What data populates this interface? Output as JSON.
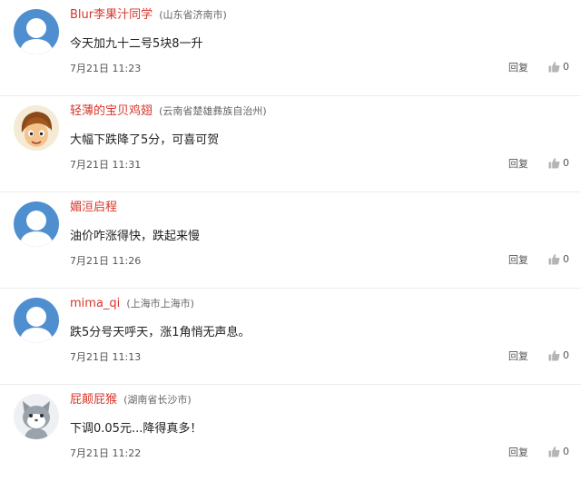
{
  "comments": [
    {
      "user": "Blur李果汁同学",
      "location": "(山东省济南市)",
      "content": "今天加九十二号5块8一升",
      "time": "7月21日 11:23",
      "reply": "回复",
      "likes": "0",
      "avatar": "default-avatar-icon"
    },
    {
      "user": "轻薄的宝贝鸡翅",
      "location": "(云南省楚雄彝族自治州)",
      "content": "大幅下跌降了5分，可喜可贺",
      "time": "7月21日 11:31",
      "reply": "回复",
      "likes": "0",
      "avatar": "cartoon-boy-avatar"
    },
    {
      "user": "媚洹启程",
      "location": "",
      "content": "油价咋涨得快，跌起来慢",
      "time": "7月21日 11:26",
      "reply": "回复",
      "likes": "0",
      "avatar": "default-avatar-icon"
    },
    {
      "user": "mima_qi",
      "location": "(上海市上海市)",
      "content": "跌5分号天呼天，涨1角悄无声息。",
      "time": "7月21日 11:13",
      "reply": "回复",
      "likes": "0",
      "avatar": "default-avatar-icon"
    },
    {
      "user": "屁颠屁猴",
      "location": "(湖南省长沙市)",
      "content": "下调0.05元...降得真多！",
      "time": "7月21日 11:22",
      "reply": "回复",
      "likes": "0",
      "avatar": "cartoon-cat-avatar"
    }
  ],
  "colors": {
    "username": "#d6362b",
    "avatar_blue": "#4f8fd0",
    "divider": "#ececec"
  }
}
